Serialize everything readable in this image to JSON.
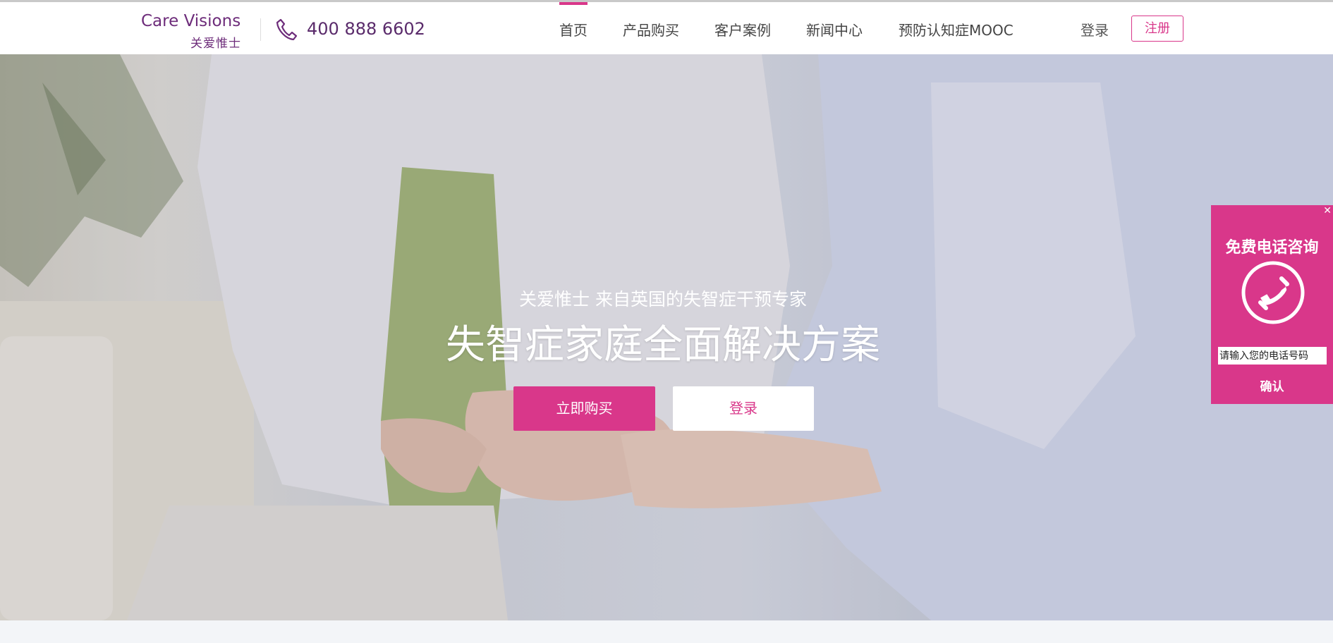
{
  "header": {
    "logo_en": "Care Visions",
    "logo_cn": "关爱惟士",
    "phone": "400 888 6602",
    "nav": [
      "首页",
      "产品购买",
      "客户案例",
      "新闻中心",
      "预防认知症MOOC"
    ],
    "active_index": 0,
    "login_label": "登录",
    "register_label": "注册"
  },
  "hero": {
    "subtitle": "关爱惟士 来自英国的失智症干预专家",
    "title": "失智症家庭全面解决方案",
    "buy_label": "立即购买",
    "login_label": "登录"
  },
  "consult": {
    "close_icon": "close-icon",
    "title": "免费电话咨询",
    "placeholder": "请输入您的电话号码",
    "confirm_label": "确认"
  },
  "colors": {
    "accent": "#d9378a",
    "brand_purple": "#6d2c7a"
  }
}
